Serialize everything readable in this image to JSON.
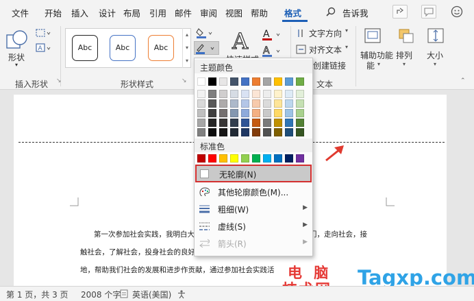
{
  "tabs": [
    "文件",
    "开始",
    "插入",
    "设计",
    "布局",
    "引用",
    "邮件",
    "审阅",
    "视图",
    "帮助",
    "格式"
  ],
  "tell_me": "告诉我",
  "ribbon": {
    "shape_button": "形状",
    "group_insert_shapes": "插入形状",
    "style_presets": [
      "Abc",
      "Abc",
      "Abc"
    ],
    "group_shape_styles": "形状样式",
    "quick_styles": "快速样式",
    "text_direction": "文字方向",
    "align_text": "对齐文本",
    "create_link": "创建链接",
    "group_text": "文本",
    "position": "辅助功能",
    "position_sub": "能",
    "arrange": "排列",
    "size": "大小"
  },
  "dropdown": {
    "theme_header": "主题颜色",
    "standard_header": "标准色",
    "items": [
      {
        "label": "无轮廓(N)",
        "highlighted": true,
        "has_submenu": false,
        "enabled": true
      },
      {
        "label": "其他轮廓颜色(M)...",
        "highlighted": false,
        "has_submenu": false,
        "enabled": true
      },
      {
        "label": "粗细(W)",
        "highlighted": false,
        "has_submenu": true,
        "enabled": true
      },
      {
        "label": "虚线(S)",
        "highlighted": false,
        "has_submenu": true,
        "enabled": true
      },
      {
        "label": "箭头(R)",
        "highlighted": false,
        "has_submenu": true,
        "enabled": false
      }
    ],
    "theme_colors_top": [
      "#ffffff",
      "#000000",
      "#e7e6e6",
      "#44546a",
      "#4472c4",
      "#ed7d31",
      "#a5a5a5",
      "#ffc000",
      "#5b9bd5",
      "#70ad47"
    ],
    "theme_colors_columns": [
      [
        "#f2f2f2",
        "#d9d9d9",
        "#bfbfbf",
        "#a6a6a6",
        "#808080"
      ],
      [
        "#7f7f7f",
        "#595959",
        "#404040",
        "#262626",
        "#0d0d0d"
      ],
      [
        "#d0cece",
        "#aeabab",
        "#757070",
        "#3a3838",
        "#171616"
      ],
      [
        "#d6dce4",
        "#adb9ca",
        "#8497b0",
        "#333f4f",
        "#222a35"
      ],
      [
        "#d9e2f3",
        "#b4c6e7",
        "#8eaadb",
        "#2f5496",
        "#1f3864"
      ],
      [
        "#fbe5d5",
        "#f7caac",
        "#f4b083",
        "#c55a11",
        "#833c0b"
      ],
      [
        "#ededed",
        "#dbdbdb",
        "#c9c9c9",
        "#7b7b7b",
        "#525252"
      ],
      [
        "#fff2cc",
        "#fee599",
        "#ffd965",
        "#bf9000",
        "#7f6000"
      ],
      [
        "#deebf6",
        "#bdd7ee",
        "#9cc3e5",
        "#2e75b5",
        "#1f4e79"
      ],
      [
        "#e2efd9",
        "#c5e0b3",
        "#a8d08d",
        "#538135",
        "#375623"
      ]
    ],
    "standard_colors": [
      "#c00000",
      "#ff0000",
      "#ffc000",
      "#ffff00",
      "#92d050",
      "#00b050",
      "#00b0f0",
      "#0070c0",
      "#002060",
      "#7030a0"
    ]
  },
  "document": {
    "line1": "第一次参加社会实践，我明白大学生社会实践是引导我们学生走出校门，走向社会，接",
    "line2": "触社会，了解社会，投身社会的良好形式；是培养锻炼才干的",
    "line3": "地，帮助我们社会的发展和进步作贡献，通过参加社会实践活"
  },
  "statusbar": {
    "page": "第 1 页，共 3 页",
    "words": "2008 个字",
    "language": "英语(美国)"
  },
  "watermark": {
    "left_top": "电 脑",
    "left_bottom": "技术网",
    "right": "Tagxp.com"
  },
  "colors": {
    "accent": "#1c5fb6",
    "highlight_border": "#d32f2f",
    "highlight_bg": "#c9c9c9",
    "arrow": "#e03a2f"
  }
}
